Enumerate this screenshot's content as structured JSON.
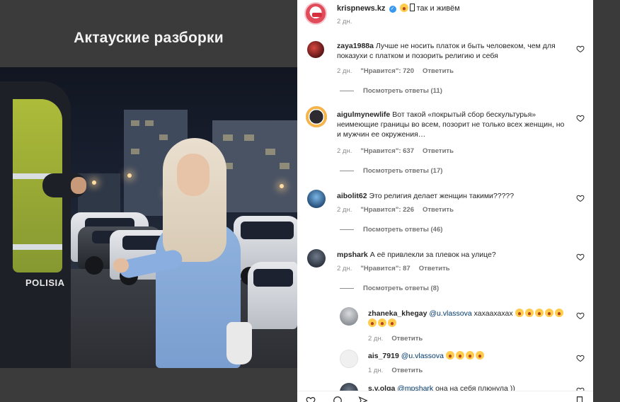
{
  "video": {
    "title": "Актауские разборки",
    "officer_label": "POLISIA"
  },
  "post": {
    "username": "krispnews.kz",
    "caption": "так и живём",
    "age": "2 дн."
  },
  "comments": [
    {
      "username": "zaya1988a",
      "text": "Лучше не носить платок и быть человеком, чем для показухи с платком и позорить религию и себя",
      "age": "2 дн.",
      "likes": "\"Нравится\": 720",
      "reply": "Ответить",
      "view_replies": "Посмотреть ответы (11)"
    },
    {
      "username": "aigulmynewlife",
      "text": "Вот такой «покрытый сбор бескультурья» неимеющие границы во всем, позорит не только всех женщин, но и мужчин ее окружения…",
      "age": "2 дн.",
      "likes": "\"Нравится\": 637",
      "reply": "Ответить",
      "view_replies": "Посмотреть ответы (17)"
    },
    {
      "username": "aibolit62",
      "text": "Это религия делает женщин такими?????",
      "age": "2 дн.",
      "likes": "\"Нравится\": 226",
      "reply": "Ответить",
      "view_replies": "Посмотреть ответы (46)"
    },
    {
      "username": "mpshark",
      "text": "А её привлекли за плевок на улице?",
      "age": "2 дн.",
      "likes": "\"Нравится\": 87",
      "reply": "Ответить",
      "view_replies": "Посмотреть ответы (8)"
    }
  ],
  "replies": [
    {
      "username": "zhaneka_khegay",
      "mention": "@u.vlassova",
      "text": "хахаахахах",
      "age": "2 дн.",
      "reply": "Ответить"
    },
    {
      "username": "ais_7919",
      "mention": "@u.vlassova",
      "text": "",
      "age": "1 дн.",
      "reply": "Ответить"
    },
    {
      "username": "s.v.olga",
      "mention": "@mpshark",
      "text": "она на себя плюнула ))"
    }
  ],
  "icons": {
    "like": "heart-icon",
    "verified": "verified-badge-icon",
    "emoji": "laughing-emoji-icon"
  },
  "colors": {
    "link": "#00376b",
    "muted": "#8e8e8e",
    "verified": "#3897f0"
  }
}
